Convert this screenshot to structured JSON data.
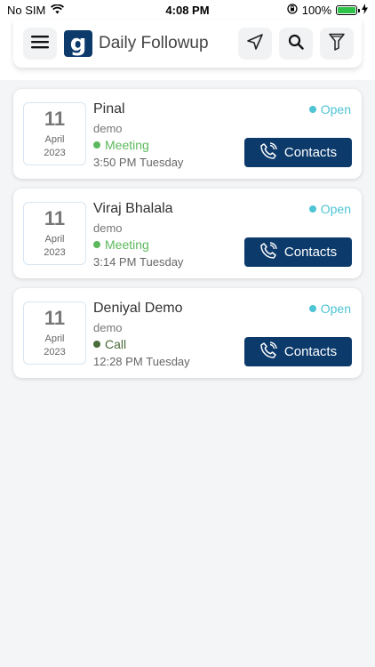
{
  "status_bar": {
    "carrier": "No SIM",
    "time": "4:08 PM",
    "battery": "100%",
    "battery_level": 1.0,
    "icons": [
      "wifi-icon",
      "orientation-lock-icon",
      "battery-icon",
      "charging-icon"
    ]
  },
  "header": {
    "logo_letter": "g",
    "title": "Daily Followup",
    "icons": [
      "menu-icon",
      "navigation-icon",
      "search-icon",
      "filter-icon"
    ]
  },
  "colors": {
    "primary": "#0c3a6b",
    "open_status": "#4ec4d4",
    "meeting": "#5cb85c",
    "call": "#4a6b3a"
  },
  "followups": [
    {
      "day": "11",
      "month": "April",
      "year": "2023",
      "name": "Pinal",
      "company": "demo",
      "type": "Meeting",
      "type_color": "#5cb85c",
      "time": "3:50 PM",
      "weekday": "Tuesday",
      "status": "Open",
      "button_label": "Contacts"
    },
    {
      "day": "11",
      "month": "April",
      "year": "2023",
      "name": "Viraj Bhalala",
      "company": "demo",
      "type": "Meeting",
      "type_color": "#5cb85c",
      "time": "3:14 PM",
      "weekday": "Tuesday",
      "status": "Open",
      "button_label": "Contacts"
    },
    {
      "day": "11",
      "month": "April",
      "year": "2023",
      "name": "Deniyal Demo",
      "company": "demo",
      "type": "Call",
      "type_color": "#4a6b3a",
      "time": "12:28 PM",
      "weekday": "Tuesday",
      "status": "Open",
      "button_label": "Contacts"
    }
  ]
}
